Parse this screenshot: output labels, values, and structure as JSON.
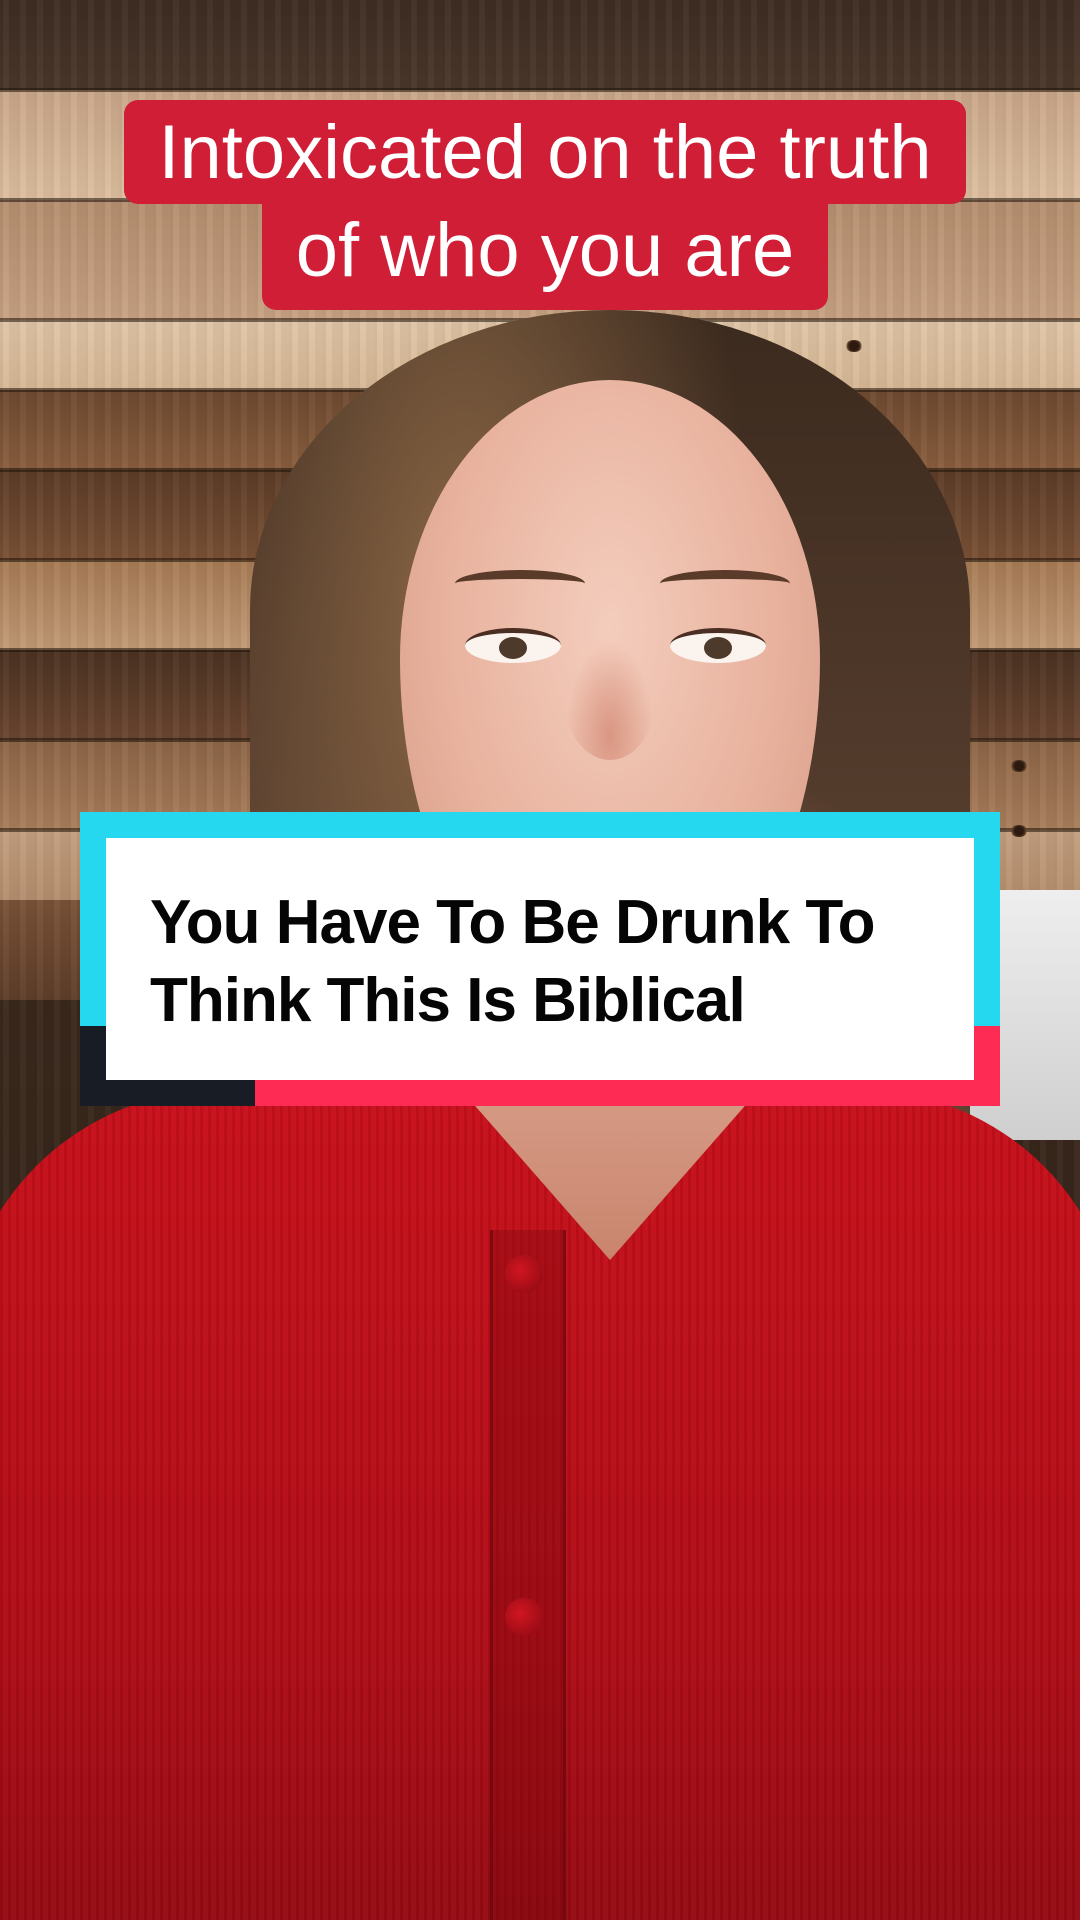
{
  "video": {
    "top_caption": {
      "line1": "Intoxicated on the truth",
      "line2": "of who you are"
    },
    "title_card": {
      "line1": "You Have To Be Drunk To",
      "line2": "Think This Is Biblical"
    },
    "colors": {
      "caption_background": "#cf1e35",
      "card_accent_cyan": "#25d7ef",
      "card_accent_red": "#fe2b54",
      "card_accent_dark": "#181c24",
      "sweater": "#c8101b"
    }
  }
}
